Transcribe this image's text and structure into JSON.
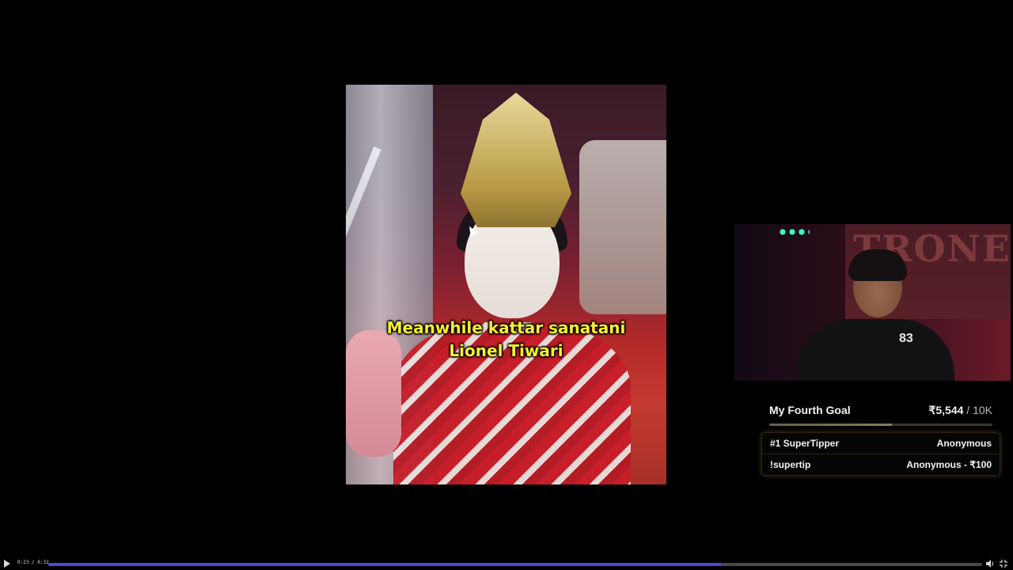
{
  "video": {
    "subtitle_line1": "Meanwhile kattar sanatani",
    "subtitle_line2": "Lionel Tiwari"
  },
  "webcam": {
    "wall_text": "TRONE",
    "jersey_number": "83"
  },
  "goal": {
    "title": "My Fourth Goal",
    "current": "₹5,544",
    "target": "/ 10K",
    "progress_fraction": 0.55,
    "rows": [
      {
        "label": "#1 SuperTipper",
        "value": "Anonymous"
      },
      {
        "label": "!supertip",
        "value": "Anonymous - ₹100"
      }
    ]
  },
  "player": {
    "time": "0:23 / 0:32",
    "progress_fraction": 0.72,
    "icons": {
      "play": "play-icon",
      "volume": "volume-icon",
      "fullscreen": "fullscreen-exit-icon"
    }
  }
}
